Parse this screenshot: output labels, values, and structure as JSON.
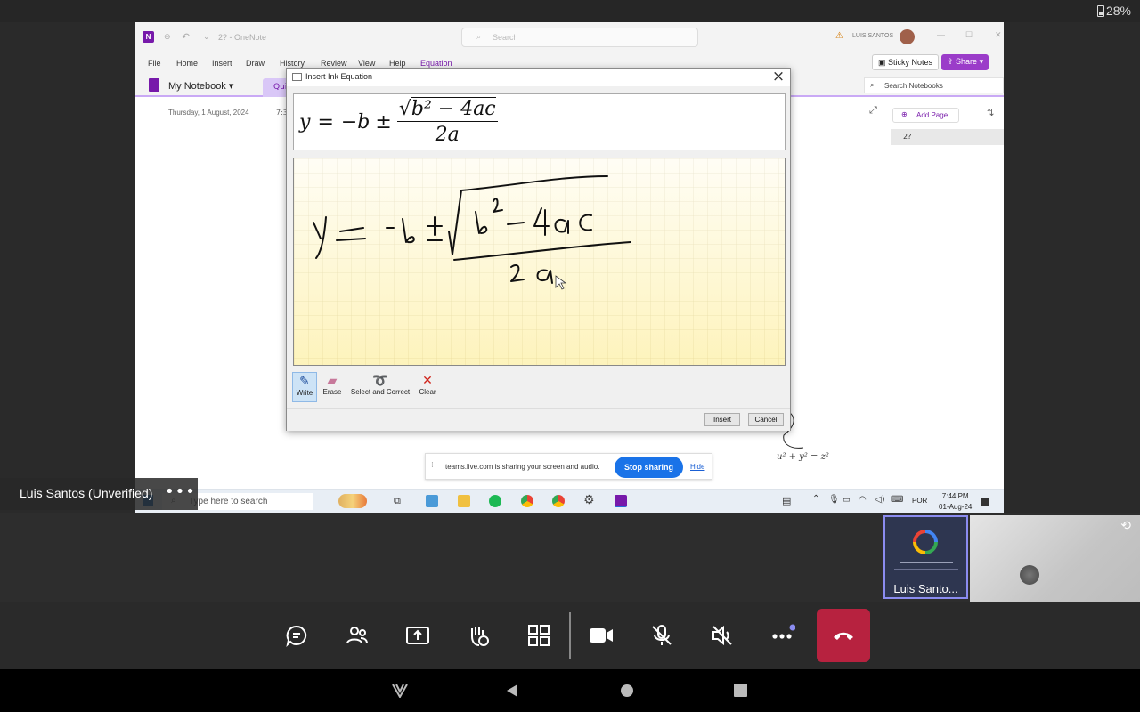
{
  "status": {
    "battery": "28%"
  },
  "onenote": {
    "title": "2? - OneNote",
    "search_placeholder": "Search",
    "user": "LUIS SANTOS",
    "menu": [
      "File",
      "Home",
      "Insert",
      "Draw",
      "History",
      "Review",
      "View",
      "Help",
      "Equation"
    ],
    "sticky_notes": "Sticky Notes",
    "share": "Share",
    "notebook": "My Notebook",
    "notebook_tab": "Qui",
    "search_notebooks": "Search Notebooks",
    "page_date": "Thursday, 1 August, 2024",
    "page_time": "7:3",
    "add_page": "Add Page",
    "page_item": "2?",
    "sum_equation": "u² + y² = z²"
  },
  "dialog": {
    "title": "Insert Ink Equation",
    "formula": {
      "lhs": "y",
      "eq": "=",
      "minus_b": "−b",
      "pm": "±",
      "numerator": "b² − 4ac",
      "denominator": "2a"
    },
    "tools": [
      {
        "label": "Write",
        "icon": "pen-icon"
      },
      {
        "label": "Erase",
        "icon": "eraser-icon"
      },
      {
        "label": "Select and Correct",
        "icon": "lasso-icon"
      },
      {
        "label": "Clear",
        "icon": "clear-icon"
      }
    ],
    "insert": "Insert",
    "cancel": "Cancel"
  },
  "share_banner": {
    "text": "teams.live.com is sharing your screen and audio.",
    "stop": "Stop sharing",
    "hide": "Hide"
  },
  "taskbar": {
    "search": "Type here to search",
    "lang": "POR",
    "time": "7:44 PM",
    "date": "01-Aug-24"
  },
  "presenter": {
    "name": "Luis Santos (Unverified)"
  },
  "self_tile": {
    "name": "Luis Santo..."
  },
  "controls": [
    "chat-icon",
    "people-icon",
    "share-screen-icon",
    "raise-hand-icon",
    "view-icon",
    "camera-icon",
    "mic-off-icon",
    "speaker-off-icon",
    "more-icon",
    "hang-up-icon"
  ],
  "colors": {
    "onenote_purple": "#7719aa",
    "stop_sharing": "#1a73e8",
    "hangup": "#b7223f",
    "self_tile_border": "#8b8cf0"
  }
}
